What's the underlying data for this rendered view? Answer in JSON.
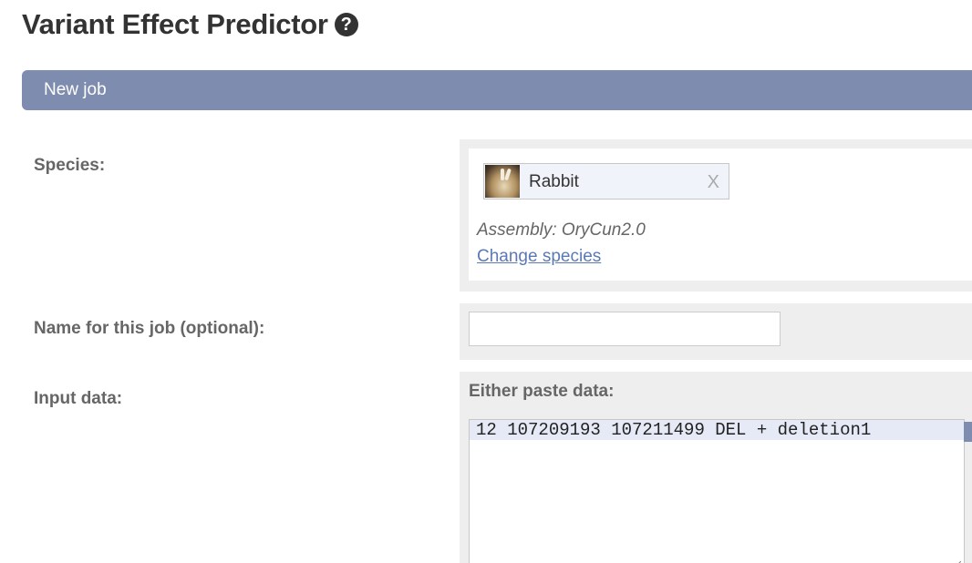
{
  "page": {
    "title": "Variant Effect Predictor",
    "help_icon": "question-circle-icon"
  },
  "panel": {
    "header_label": "New job"
  },
  "species": {
    "label": "Species:",
    "selected": "Rabbit",
    "remove_label": "X",
    "assembly": "Assembly: OryCun2.0",
    "change_link": "Change species"
  },
  "job_name": {
    "label": "Name for this job (optional):",
    "value": "",
    "placeholder": ""
  },
  "input_data": {
    "label": "Input data:",
    "paste_label": "Either paste data:",
    "paste_value": "12 107209193 107211499 DEL + deletion1"
  },
  "colors": {
    "header_bg": "#7e8daf",
    "link": "#5b79b4",
    "field_bg": "#eeeeee"
  }
}
